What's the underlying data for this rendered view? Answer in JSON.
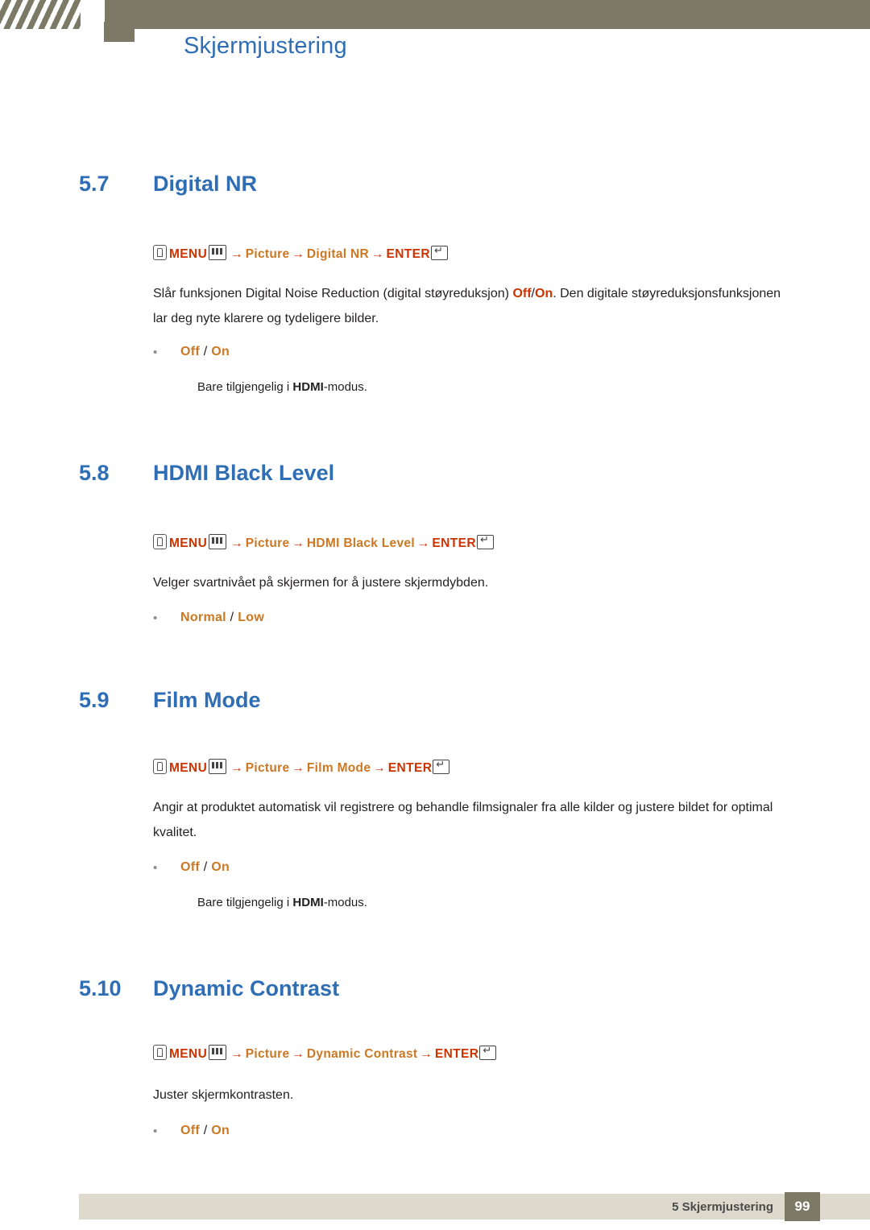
{
  "header": {
    "title": "Skjermjustering"
  },
  "sections": [
    {
      "number": "5.7",
      "name": "Digital NR",
      "path": {
        "menu_label": "MENU",
        "arrow": "→",
        "seg1": "Picture",
        "seg2": "Digital NR",
        "enter_label": "ENTER"
      },
      "body_parts": [
        {
          "text": "Slår funksjonen Digital Noise Reduction (digital støyreduksjon) ",
          "style": "plain"
        },
        {
          "text": "Off",
          "style": "red"
        },
        {
          "text": "/",
          "style": "plain"
        },
        {
          "text": "On",
          "style": "red"
        },
        {
          "text": ". Den digitale støyreduksjonsfunksjonen lar deg nyte klarere og tydeligere bilder.",
          "style": "plain"
        }
      ],
      "bullet": {
        "opt1": "Off",
        "sep": " / ",
        "opt2": "On"
      },
      "note_pre": "Bare tilgjengelig i ",
      "note_bold": "HDMI",
      "note_post": "-modus."
    },
    {
      "number": "5.8",
      "name": "HDMI Black Level",
      "path": {
        "menu_label": "MENU",
        "arrow": "→",
        "seg1": "Picture",
        "seg2": "HDMI Black Level",
        "enter_label": "ENTER"
      },
      "body_parts": [
        {
          "text": "Velger svartnivået på skjermen for å justere skjermdybden.",
          "style": "plain"
        }
      ],
      "bullet": {
        "opt1": "Normal",
        "sep": " / ",
        "opt2": "Low"
      },
      "note_pre": "",
      "note_bold": "",
      "note_post": ""
    },
    {
      "number": "5.9",
      "name": "Film Mode",
      "path": {
        "menu_label": "MENU",
        "arrow": "→",
        "seg1": "Picture",
        "seg2": "Film Mode",
        "enter_label": "ENTER"
      },
      "body_parts": [
        {
          "text": "Angir at produktet automatisk vil registrere og behandle filmsignaler fra alle kilder og justere bildet for optimal kvalitet.",
          "style": "plain"
        }
      ],
      "bullet": {
        "opt1": "Off",
        "sep": " / ",
        "opt2": "On"
      },
      "note_pre": "Bare tilgjengelig i ",
      "note_bold": "HDMI",
      "note_post": "-modus."
    },
    {
      "number": "5.10",
      "name": "Dynamic Contrast",
      "path": {
        "menu_label": "MENU",
        "arrow": "→",
        "seg1": "Picture",
        "seg2": "Dynamic Contrast",
        "enter_label": "ENTER"
      },
      "body_parts": [
        {
          "text": "Juster skjermkontrasten.",
          "style": "plain"
        }
      ],
      "bullet": {
        "opt1": "Off",
        "sep": " / ",
        "opt2": "On"
      },
      "note_pre": "",
      "note_bold": "",
      "note_post": ""
    }
  ],
  "footer": {
    "chapter": "5 Skjermjustering",
    "page_number": "99"
  },
  "colors": {
    "heading_blue": "#2f6eb5",
    "keyword_red": "#cc3300",
    "option_orange": "#cc7722",
    "header_band": "#7c7a66",
    "footer_band": "#ddd9cc"
  }
}
